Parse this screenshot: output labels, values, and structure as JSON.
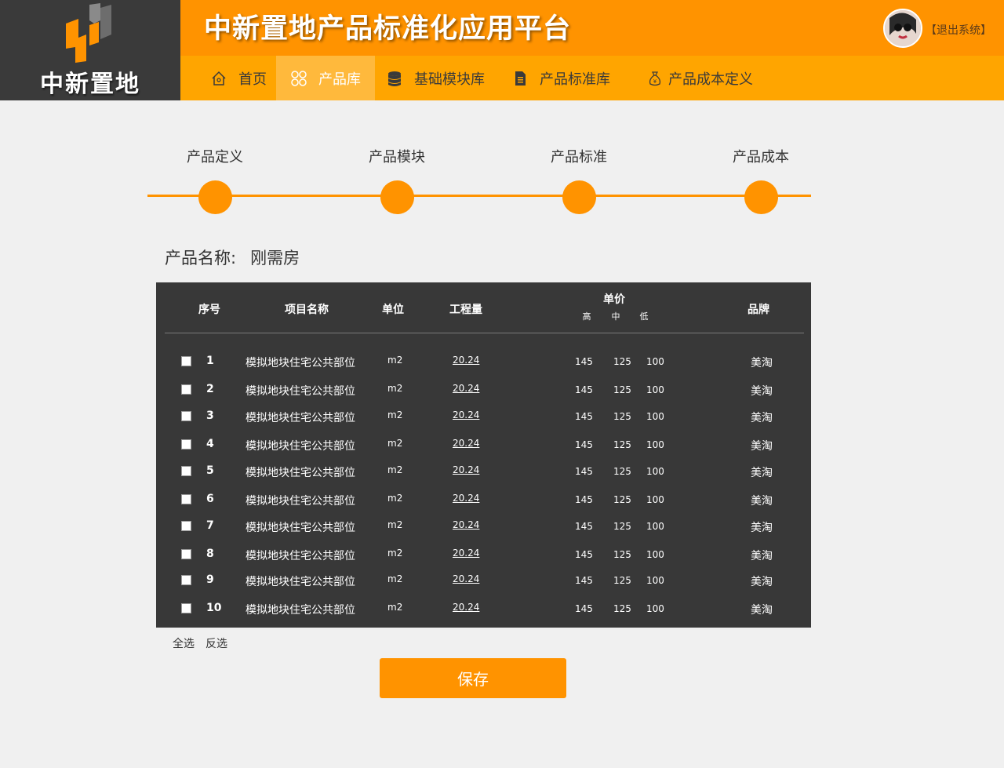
{
  "brand": {
    "logo_text": "中新置地",
    "platform_title": "中新置地产品标准化应用平台"
  },
  "user": {
    "logout_label": "【退出系统】"
  },
  "nav": {
    "items": [
      {
        "label": "首页",
        "icon": "home-icon"
      },
      {
        "label": "产品库",
        "icon": "grid-icon",
        "active": true
      },
      {
        "label": "基础模块库",
        "icon": "database-icon"
      },
      {
        "label": "产品标准库",
        "icon": "document-icon"
      },
      {
        "label": "产品成本定义",
        "icon": "money-bag-icon"
      }
    ]
  },
  "steps": [
    "产品定义",
    "产品模块",
    "产品标准",
    "产品成本"
  ],
  "product": {
    "label": "产品名称:",
    "value": "刚需房"
  },
  "table": {
    "headers": {
      "seq": "序号",
      "name": "项目名称",
      "unit": "单位",
      "qty": "工程量",
      "price": "单价",
      "brand": "品牌",
      "price_sub": [
        "高",
        "中",
        "低"
      ]
    },
    "rows": [
      {
        "seq": "1",
        "name": "模拟地块住宅公共部位",
        "unit": "m2",
        "qty": "20.24",
        "high": "145",
        "mid": "125",
        "low": "100",
        "brand": "美淘"
      },
      {
        "seq": "2",
        "name": "模拟地块住宅公共部位",
        "unit": "m2",
        "qty": "20.24",
        "high": "145",
        "mid": "125",
        "low": "100",
        "brand": "美淘"
      },
      {
        "seq": "3",
        "name": "模拟地块住宅公共部位",
        "unit": "m2",
        "qty": "20.24",
        "high": "145",
        "mid": "125",
        "low": "100",
        "brand": "美淘"
      },
      {
        "seq": "4",
        "name": "模拟地块住宅公共部位",
        "unit": "m2",
        "qty": "20.24",
        "high": "145",
        "mid": "125",
        "low": "100",
        "brand": "美淘"
      },
      {
        "seq": "5",
        "name": "模拟地块住宅公共部位",
        "unit": "m2",
        "qty": "20.24",
        "high": "145",
        "mid": "125",
        "low": "100",
        "brand": "美淘"
      },
      {
        "seq": "6",
        "name": "模拟地块住宅公共部位",
        "unit": "m2",
        "qty": "20.24",
        "high": "145",
        "mid": "125",
        "low": "100",
        "brand": "美淘"
      },
      {
        "seq": "7",
        "name": "模拟地块住宅公共部位",
        "unit": "m2",
        "qty": "20.24",
        "high": "145",
        "mid": "125",
        "low": "100",
        "brand": "美淘"
      },
      {
        "seq": "8",
        "name": "模拟地块住宅公共部位",
        "unit": "m2",
        "qty": "20.24",
        "high": "145",
        "mid": "125",
        "low": "100",
        "brand": "美淘"
      },
      {
        "seq": "9",
        "name": "模拟地块住宅公共部位",
        "unit": "m2",
        "qty": "20.24",
        "high": "145",
        "mid": "125",
        "low": "100",
        "brand": "美淘"
      },
      {
        "seq": "10",
        "name": "模拟地块住宅公共部位",
        "unit": "m2",
        "qty": "20.24",
        "high": "145",
        "mid": "125",
        "low": "100",
        "brand": "美淘"
      }
    ]
  },
  "actions": {
    "select_all": "全选",
    "invert": "反选",
    "save": "保存"
  },
  "colors": {
    "accent": "#ff9300",
    "nav_bg": "#ffa500",
    "panel_bg": "#383838",
    "logo_bg": "#3a3a3a"
  }
}
